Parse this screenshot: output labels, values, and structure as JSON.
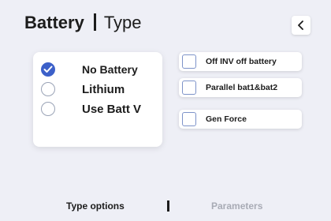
{
  "header": {
    "title": "Battery",
    "subtitle": "Type",
    "back_icon": "chevron-left-icon"
  },
  "battery_type": {
    "options": [
      {
        "label": "No Battery",
        "checked": true
      },
      {
        "label": "Lithium",
        "checked": false
      },
      {
        "label": "Use Batt V",
        "checked": false
      }
    ]
  },
  "flags": {
    "items": [
      {
        "label": "Off INV off battery",
        "checked": false
      },
      {
        "label": "Parallel bat1&bat2",
        "checked": false
      },
      {
        "label": "Gen Force",
        "checked": false
      }
    ]
  },
  "tabs": [
    {
      "label": "Type options",
      "active": true
    },
    {
      "label": "Parameters",
      "active": false
    }
  ],
  "colors": {
    "background": "#eeeff6",
    "accent": "#3c60c9",
    "inactive_tab": "#a8abb5"
  }
}
